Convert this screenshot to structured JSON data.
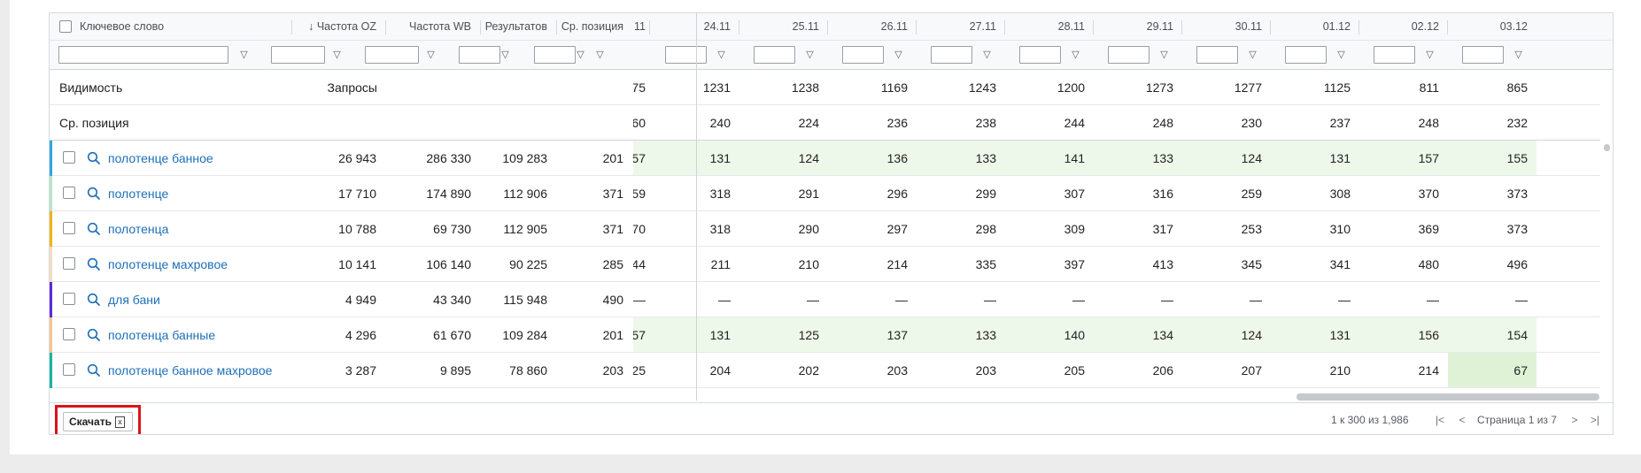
{
  "header": {
    "keyword": "Ключевое слово",
    "freq_oz": "↓ Частота OZ",
    "freq_wb": "Частота WB",
    "results": "Результатов",
    "avg_pos": "Ср. позиция",
    "partial_date": "11",
    "dates": [
      "24.11",
      "25.11",
      "26.11",
      "27.11",
      "28.11",
      "29.11",
      "30.11",
      "01.12",
      "02.12",
      "03.12"
    ]
  },
  "pinned_rows": [
    {
      "label": "Видимость",
      "mid_label": "Запросы",
      "partial": "75",
      "values": [
        "1231",
        "1238",
        "1169",
        "1243",
        "1200",
        "1273",
        "1277",
        "1125",
        "811",
        "865"
      ]
    },
    {
      "label": "Ср. позиция",
      "mid_label": "",
      "partial": "60",
      "values": [
        "240",
        "224",
        "236",
        "238",
        "244",
        "248",
        "230",
        "237",
        "248",
        "232"
      ]
    }
  ],
  "rows": [
    {
      "keyword": "полотенце банное",
      "freq_oz": "26 943",
      "freq_wb": "286 330",
      "results": "109 283",
      "avg_pos": "201",
      "partial": "57",
      "values": [
        "131",
        "124",
        "136",
        "133",
        "141",
        "133",
        "124",
        "131",
        "157",
        "155"
      ],
      "color": "#2ea7e0",
      "tinted": true
    },
    {
      "keyword": "полотенце",
      "freq_oz": "17 710",
      "freq_wb": "174 890",
      "results": "112 906",
      "avg_pos": "371",
      "partial": "59",
      "values": [
        "318",
        "291",
        "296",
        "299",
        "307",
        "316",
        "259",
        "308",
        "370",
        "373"
      ],
      "color": "#b9e3c9",
      "tinted": false
    },
    {
      "keyword": "полотенца",
      "freq_oz": "10 788",
      "freq_wb": "69 730",
      "results": "112 905",
      "avg_pos": "371",
      "partial": "70",
      "values": [
        "318",
        "290",
        "297",
        "298",
        "309",
        "317",
        "253",
        "310",
        "369",
        "373"
      ],
      "color": "#f2b319",
      "tinted": false
    },
    {
      "keyword": "полотенце махровое",
      "freq_oz": "10 141",
      "freq_wb": "106 140",
      "results": "90 225",
      "avg_pos": "285",
      "partial": "44",
      "values": [
        "211",
        "210",
        "214",
        "335",
        "397",
        "413",
        "345",
        "341",
        "480",
        "496"
      ],
      "color": "#f6dcc0",
      "tinted": false
    },
    {
      "keyword": "для бани",
      "freq_oz": "4 949",
      "freq_wb": "43 340",
      "results": "115 948",
      "avg_pos": "490",
      "partial": "—",
      "values": [
        "—",
        "—",
        "—",
        "—",
        "—",
        "—",
        "—",
        "—",
        "—",
        "—"
      ],
      "color": "#5b2bd9",
      "tinted": false
    },
    {
      "keyword": "полотенца банные",
      "freq_oz": "4 296",
      "freq_wb": "61 670",
      "results": "109 284",
      "avg_pos": "201",
      "partial": "57",
      "values": [
        "131",
        "125",
        "137",
        "133",
        "140",
        "134",
        "124",
        "131",
        "156",
        "154"
      ],
      "color": "#f6c490",
      "tinted": true
    },
    {
      "keyword": "полотенце банное махровое",
      "freq_oz": "3 287",
      "freq_wb": "9 895",
      "results": "78 860",
      "avg_pos": "203",
      "partial": "25",
      "values": [
        "204",
        "202",
        "203",
        "203",
        "205",
        "206",
        "207",
        "210",
        "214",
        "67"
      ],
      "color": "#17b3a3",
      "tinted": false,
      "last_highlight": true
    }
  ],
  "footer": {
    "download_label": "Скачать",
    "excel_icon": "x",
    "range_text": "1 к 300 из 1,986",
    "page_text": "Страница 1 из 7"
  }
}
